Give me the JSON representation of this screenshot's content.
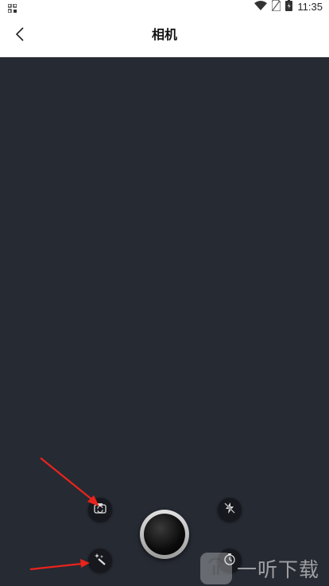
{
  "status_bar": {
    "time": "11:35",
    "icons": [
      "qr-icon",
      "wifi-icon",
      "sim-icon",
      "battery-icon"
    ]
  },
  "header": {
    "title": "相机",
    "back_icon": "chevron-left-icon"
  },
  "camera": {
    "controls": [
      "switch-camera-button",
      "beauty-filter-button",
      "shutter-button",
      "flash-toggle-button",
      "timer-button"
    ],
    "viewfinder_color": "#262a33"
  },
  "annotations": {
    "arrow_color": "#e8241c"
  },
  "watermark": {
    "text": "一听下载"
  }
}
